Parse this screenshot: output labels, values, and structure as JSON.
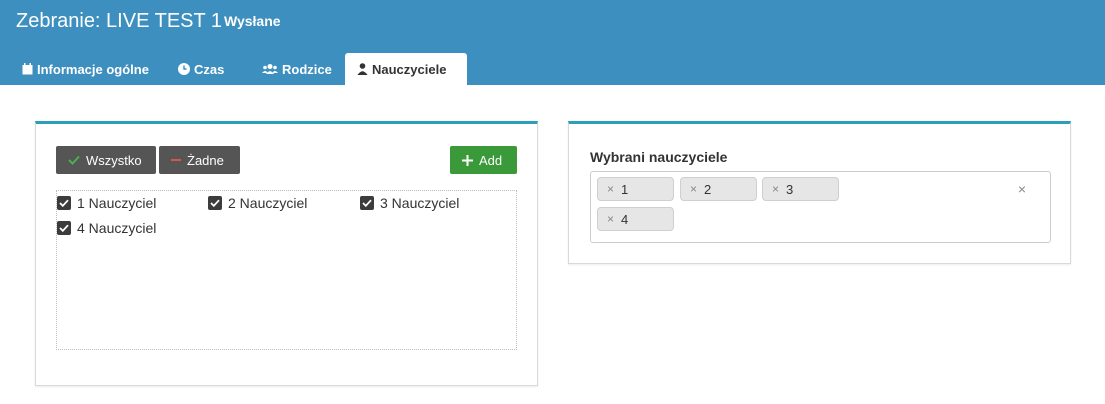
{
  "header": {
    "title": "Zebranie: LIVE TEST 1",
    "status": "Wysłane",
    "background_color": "#3d8fbf"
  },
  "tabs": [
    {
      "label": "Informacje ogólne",
      "icon": "calendar-icon",
      "active": false
    },
    {
      "label": "Czas",
      "icon": "clock-icon",
      "active": false
    },
    {
      "label": "Rodzice",
      "icon": "users-icon",
      "active": false
    },
    {
      "label": "Nauczyciele",
      "icon": "user-icon",
      "active": true
    }
  ],
  "left_panel": {
    "all_button": "Wszystko",
    "none_button": "Żadne",
    "add_button": "Add",
    "teachers": [
      {
        "label": "1 Nauczyciel",
        "checked": true
      },
      {
        "label": "2 Nauczyciel",
        "checked": true
      },
      {
        "label": "3 Nauczyciel",
        "checked": true
      },
      {
        "label": "4 Nauczyciel",
        "checked": true
      }
    ]
  },
  "right_panel": {
    "label": "Wybrani nauczyciele",
    "selected": [
      "1",
      "2",
      "3",
      "4"
    ],
    "chip_remove_glyph": "×",
    "clear_glyph": "×"
  },
  "colors": {
    "accent": "#2b9fba",
    "add_button": "#3a9a3a",
    "dark_button": "#555555"
  }
}
